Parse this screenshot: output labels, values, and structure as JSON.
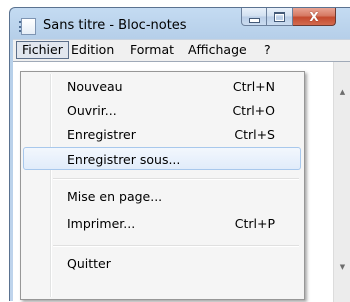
{
  "window": {
    "title": "Sans titre - Bloc-notes",
    "close_glyph": "X"
  },
  "menubar": {
    "items": [
      {
        "label": "Fichier",
        "open": true
      },
      {
        "label": "Edition"
      },
      {
        "label": "Format"
      },
      {
        "label": "Affichage"
      },
      {
        "label": "?"
      }
    ]
  },
  "file_menu": {
    "items": [
      {
        "label": "Nouveau",
        "shortcut": "Ctrl+N"
      },
      {
        "label": "Ouvrir...",
        "shortcut": "Ctrl+O"
      },
      {
        "label": "Enregistrer",
        "shortcut": "Ctrl+S"
      },
      {
        "label": "Enregistrer sous...",
        "shortcut": "",
        "highlighted": true
      },
      {
        "label": "Mise en page...",
        "shortcut": ""
      },
      {
        "label": "Imprimer...",
        "shortcut": "Ctrl+P"
      },
      {
        "label": "Quitter",
        "shortcut": ""
      }
    ]
  },
  "scrollbar": {
    "up_glyph": "▲",
    "down_glyph": "▼"
  },
  "colors": {
    "highlight_border": "#a8c8ec",
    "close_button": "#c44a2e",
    "frame": "#b6cfe9"
  },
  "icons": [
    "notepad-icon",
    "minimize-icon",
    "maximize-icon",
    "close-icon",
    "scroll-up-arrow-icon",
    "scroll-down-arrow-icon"
  ]
}
